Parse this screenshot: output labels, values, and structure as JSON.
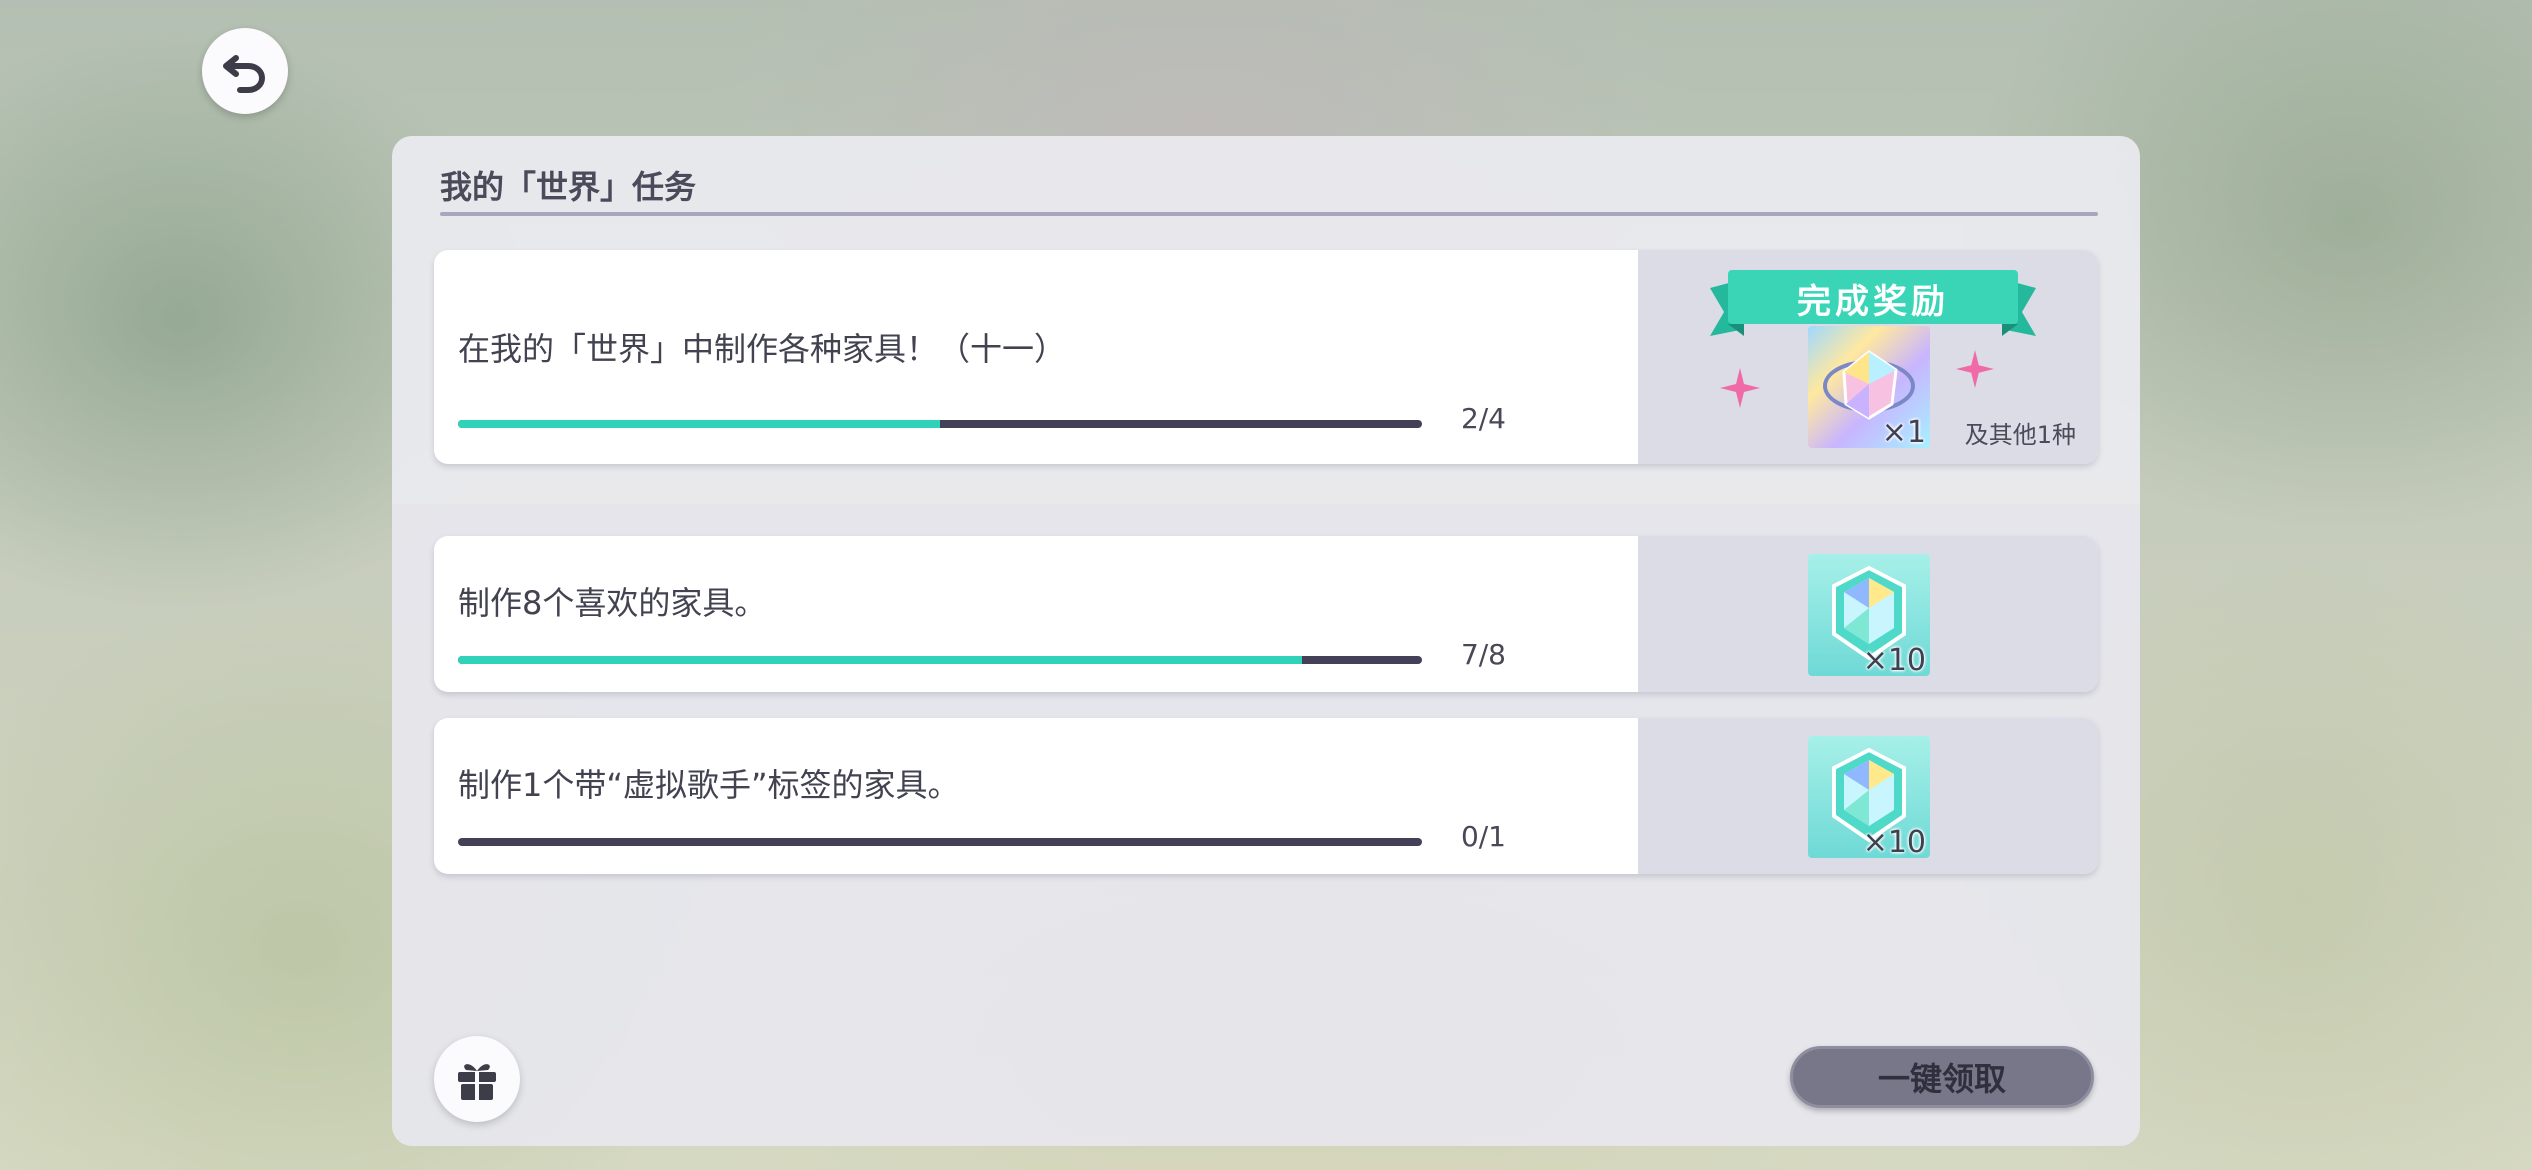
{
  "colors": {
    "progress_fill": "#30d3b9",
    "progress_track": "#434058",
    "ribbon": "#3ad5b7",
    "claim_button": "#777789"
  },
  "header": {
    "back_icon": "back-arrow-icon"
  },
  "panel": {
    "title": "我的「世界」任务"
  },
  "tasks": [
    {
      "text": "在我的「世界」中制作各种家具！（十一）",
      "progress": 0.5,
      "count": "2/4",
      "reward": {
        "banner": "完成奖励",
        "item_icon": "rainbow-gem-icon",
        "quantity": "×1",
        "others": "及其他1种"
      }
    },
    {
      "text": "制作8个喜欢的家具。",
      "progress": 0.875,
      "count": "7/8",
      "reward": {
        "item_icon": "crystal-gem-icon",
        "quantity": "×10"
      }
    },
    {
      "text": "制作1个带“虚拟歌手”标签的家具。",
      "progress": 0,
      "count": "0/1",
      "reward": {
        "item_icon": "crystal-gem-icon",
        "quantity": "×10"
      }
    }
  ],
  "footer": {
    "gift_icon": "gift-icon",
    "claim_all_label": "一键领取"
  }
}
